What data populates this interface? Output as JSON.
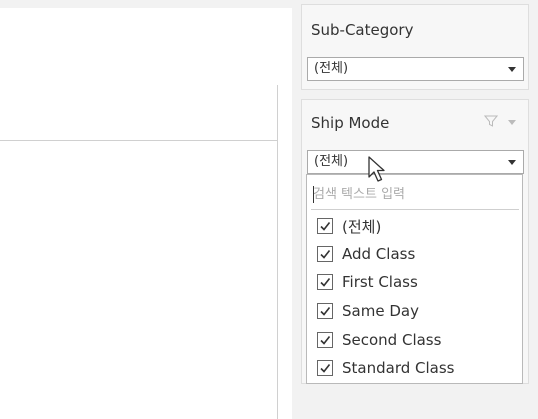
{
  "sub_category": {
    "title": "Sub-Category",
    "selected": "(전체)"
  },
  "ship_mode": {
    "title": "Ship Mode",
    "selected": "(전체)",
    "search_placeholder": "검색 텍스트 입력",
    "options": [
      {
        "label": "(전체)",
        "checked": true
      },
      {
        "label": "Add Class",
        "checked": true
      },
      {
        "label": "First Class",
        "checked": true
      },
      {
        "label": "Same Day",
        "checked": true
      },
      {
        "label": "Second Class",
        "checked": true
      },
      {
        "label": "Standard Class",
        "checked": true
      }
    ]
  },
  "icons": {
    "filter": "funnel-icon",
    "menu": "menu-arrow-icon",
    "cursor": "mouse-pointer-icon",
    "checkmark": "checkmark-icon"
  },
  "colors": {
    "pane_background": "#f2f2f2",
    "card_background": "#f7f7f7",
    "border": "#aaaaaa"
  }
}
